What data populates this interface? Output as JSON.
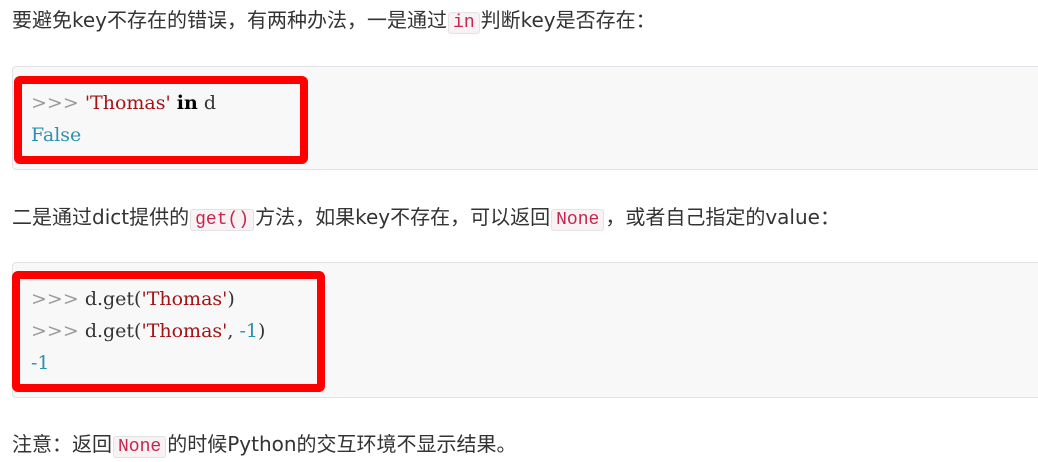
{
  "paragraph1": {
    "before": "要避免key不存在的错误，有两种办法，一是通过",
    "code": "in",
    "after": "判断key是否存在："
  },
  "code_block1": {
    "line1": {
      "prompt": ">>> ",
      "string": "'Thomas'",
      "keyword": "in",
      "rest": "d"
    },
    "line2": "False"
  },
  "paragraph2": {
    "before": "二是通过dict提供的",
    "code1": "get()",
    "middle": "方法，如果key不存在，可以返回",
    "code2": "None",
    "after": "，或者自己指定的value："
  },
  "code_block2": {
    "line1": {
      "prompt": ">>> ",
      "call": "d.get(",
      "string": "'Thomas'",
      "close": ")"
    },
    "line2": {
      "prompt": ">>> ",
      "call": "d.get(",
      "string": "'Thomas'",
      "sep": ", ",
      "number": "-1",
      "close": ")"
    },
    "line3": "-1"
  },
  "paragraph3": {
    "before": "注意：返回",
    "code": "None",
    "after": "的时候Python的交互环境不显示结果。"
  },
  "colors": {
    "highlight": "#ff0000",
    "inline_code_text": "#c7254e",
    "string": "#a31515",
    "output": "#2b91af"
  }
}
